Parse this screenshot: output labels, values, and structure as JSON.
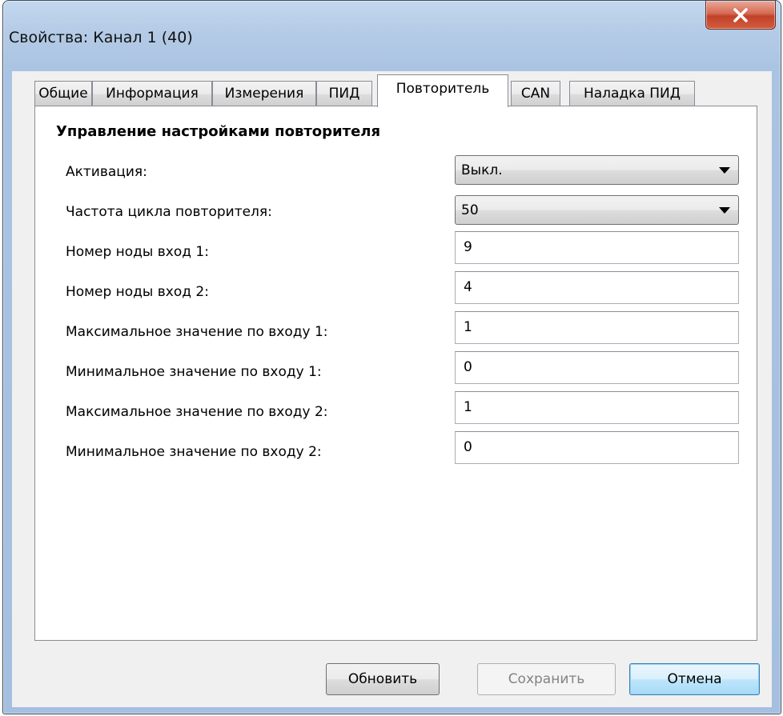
{
  "window": {
    "title": "Свойства: Канал 1 (40)"
  },
  "tabs": [
    {
      "label": "Общие",
      "active": false
    },
    {
      "label": "Информация",
      "active": false
    },
    {
      "label": "Измерения",
      "active": false
    },
    {
      "label": "ПИД",
      "active": false
    },
    {
      "label": "Повторитель",
      "active": true
    },
    {
      "label": "CAN",
      "active": false
    },
    {
      "label": "Наладка ПИД",
      "active": false
    }
  ],
  "section": {
    "title": "Управление настройками повторителя"
  },
  "settings": {
    "activation": {
      "label": "Активация:",
      "value": "Выкл."
    },
    "cycle_frequency": {
      "label": "Частота цикла повторителя:",
      "value": "50"
    },
    "node_input1": {
      "label": "Номер ноды вход 1:",
      "value": "9"
    },
    "node_input2": {
      "label": "Номер ноды вход 2:",
      "value": "4"
    },
    "max_input1": {
      "label": "Максимальное значение по входу 1:",
      "value": "1"
    },
    "min_input1": {
      "label": "Минимальное значение по входу 1:",
      "value": "0"
    },
    "max_input2": {
      "label": "Максимальное значение по входу 2:",
      "value": "1"
    },
    "min_input2": {
      "label": "Минимальное значение по входу 2:",
      "value": "0"
    }
  },
  "buttons": {
    "refresh": "Обновить",
    "save": "Сохранить",
    "cancel": "Отмена"
  },
  "icons": {
    "close": "close-icon",
    "dropdown": "chevron-down-icon"
  },
  "colors": {
    "close_button": "#c94a35",
    "default_button": "#3c7fb1",
    "titlebar": "#b4cbe6"
  }
}
